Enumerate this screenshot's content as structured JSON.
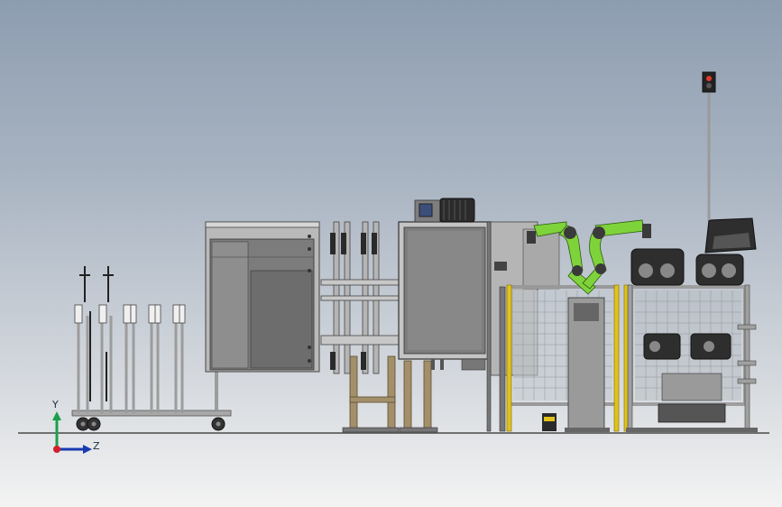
{
  "viewport": {
    "background_top": "#8d9db0",
    "background_bottom": "#f3f3f3"
  },
  "colors": {
    "frame_gray": "#a8a8a8",
    "panel_dark": "#6f6f6f",
    "panel_mid": "#8c8c8c",
    "panel_light": "#c9c9c9",
    "robot_green": "#7fd33a",
    "robot_dark": "#3a3a3a",
    "safety_yellow": "#e0c21a",
    "wood_tan": "#a38f6a",
    "mesh_gray": "#9aa2aa",
    "blue_motor": "#3b4f7a",
    "traffic_red": "#e23a2a",
    "axis_x": "#d0202a",
    "axis_y": "#1aa04a",
    "axis_z": "#1a3ab0"
  },
  "triad": {
    "y_label": "Y",
    "z_label": "Z"
  },
  "components": [
    "tool-rack-cart",
    "sheet-cabinet-enclosure",
    "clamp-fixture-stand",
    "motor-cabinet",
    "dual-arm-robot-cell",
    "tire-processing-machine",
    "signal-tower"
  ]
}
